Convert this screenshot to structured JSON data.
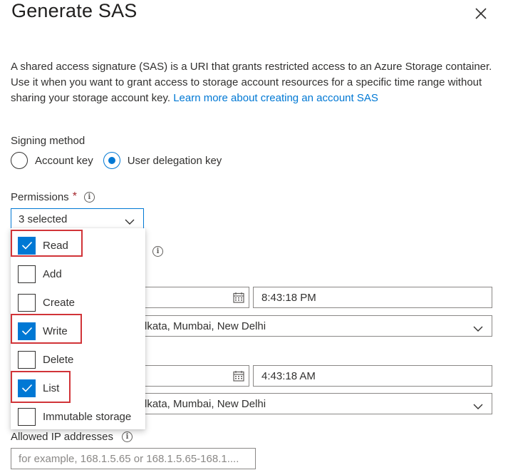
{
  "panel": {
    "title": "Generate SAS"
  },
  "description": {
    "text": "A shared access signature (SAS) is a URI that grants restricted access to an Azure Storage container. Use it when you want to grant access to storage account resources for a specific time range without sharing your storage account key. ",
    "link": "Learn more about creating an account SAS"
  },
  "signing_method": {
    "label": "Signing method",
    "options": [
      "Account key",
      "User delegation key"
    ],
    "selected": "User delegation key"
  },
  "permissions": {
    "label": "Permissions",
    "required_mark": "*",
    "selected_text": "3 selected",
    "options": [
      {
        "label": "Read",
        "checked": true
      },
      {
        "label": "Add",
        "checked": false
      },
      {
        "label": "Create",
        "checked": false
      },
      {
        "label": "Write",
        "checked": true
      },
      {
        "label": "Delete",
        "checked": false
      },
      {
        "label": "List",
        "checked": true
      },
      {
        "label": "Immutable storage",
        "checked": false
      }
    ]
  },
  "start": {
    "time": "8:43:18 PM",
    "timezone": "lkata, Mumbai, New Delhi"
  },
  "expiry": {
    "time": "4:43:18 AM",
    "timezone": "lkata, Mumbai, New Delhi"
  },
  "allowed_ip": {
    "label": "Allowed IP addresses",
    "placeholder": "for example, 168.1.5.65 or 168.1.5.65-168.1...."
  },
  "colors": {
    "accent": "#0078d4",
    "highlight": "#d13438"
  }
}
